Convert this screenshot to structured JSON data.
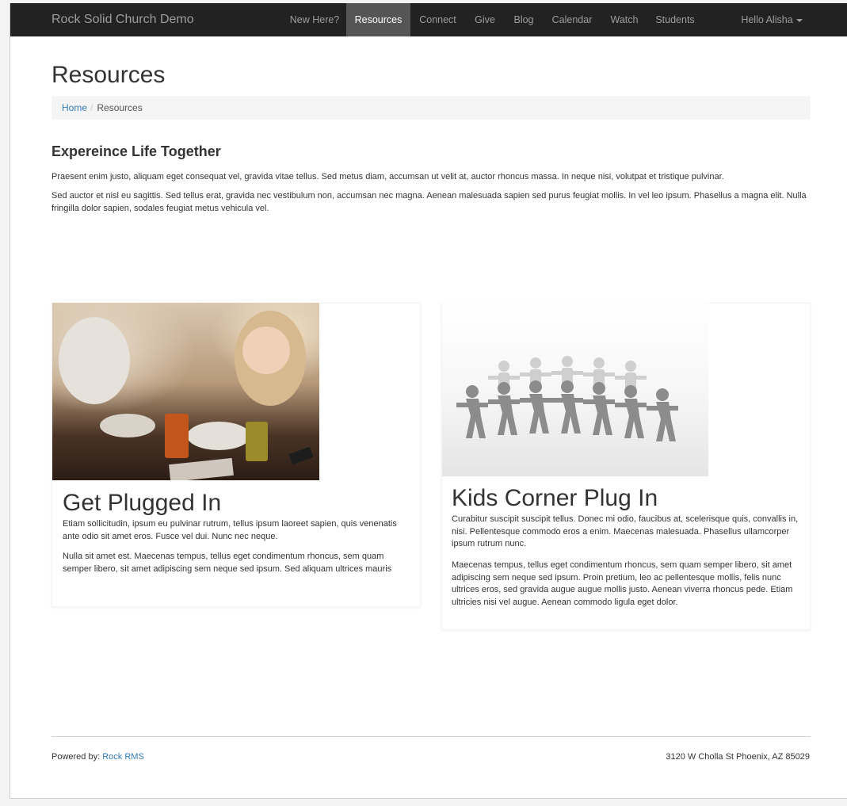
{
  "navbar": {
    "brand": "Rock Solid Church Demo",
    "items": [
      {
        "label": "New Here?",
        "active": false
      },
      {
        "label": "Resources",
        "active": true
      },
      {
        "label": "Connect",
        "active": false
      },
      {
        "label": "Give",
        "active": false
      },
      {
        "label": "Blog",
        "active": false
      },
      {
        "label": "Calendar",
        "active": false
      },
      {
        "label": "Watch",
        "active": false
      },
      {
        "label": "Students",
        "active": false
      }
    ],
    "user_menu": "Hello Alisha"
  },
  "page": {
    "title": "Resources"
  },
  "breadcrumb": {
    "home": "Home",
    "separator": "/",
    "current": "Resources"
  },
  "intro": {
    "heading": "Expereince Life Together",
    "paragraph1": "Praesent enim justo, aliquam eget consequat vel, gravida vitae tellus. Sed metus diam, accumsan ut velit at, auctor rhoncus massa. In neque nisi, volutpat et tristique pulvinar.",
    "paragraph2": "Sed auctor et nisl eu sagittis. Sed tellus erat, gravida nec vestibulum non, accumsan nec magna. Aenean malesuada sapien sed purus feugiat mollis. In vel leo ipsum. Phasellus a magna elit. Nulla fringilla dolor sapien, sodales feugiat metus vehicula vel."
  },
  "cards": [
    {
      "title": "Get Plugged In",
      "image": "dinner-table-photo",
      "paragraph1": "Etiam sollicitudin, ipsum eu pulvinar rutrum, tellus ipsum laoreet sapien, quis venenatis ante odio sit amet eros. Fusce vel dui. Nunc nec neque.",
      "paragraph2": "Nulla sit amet est. Maecenas tempus, tellus eget condimentum rhoncus, sem quam semper libero, sit amet adipiscing sem neque sed ipsum. Sed aliquam ultrices mauris"
    },
    {
      "title": "Kids Corner Plug In",
      "image": "paper-people-chain-photo",
      "paragraph1": "Curabitur suscipit suscipit tellus. Donec mi odio, faucibus at, scelerisque quis, convallis in, nisi. Pellentesque commodo eros a enim. Maecenas malesuada. Phasellus ullamcorper ipsum rutrum nunc.",
      "paragraph2": "Maecenas tempus, tellus eget condimentum rhoncus, sem quam semper libero, sit amet adipiscing sem neque sed ipsum. Proin pretium, leo ac pellentesque mollis, felis nunc ultrices eros, sed gravida augue augue mollis justo. Aenean viverra rhoncus pede. Etiam ultricies nisi vel augue. Aenean commodo ligula eget dolor."
    }
  ],
  "footer": {
    "powered_by_label": "Powered by:",
    "powered_by_link": "Rock RMS",
    "address": "3120 W Cholla St Phoenix, AZ 85029"
  },
  "colors": {
    "navbar_bg": "#222222",
    "navbar_active_bg": "#555555",
    "link": "#337ab7"
  }
}
